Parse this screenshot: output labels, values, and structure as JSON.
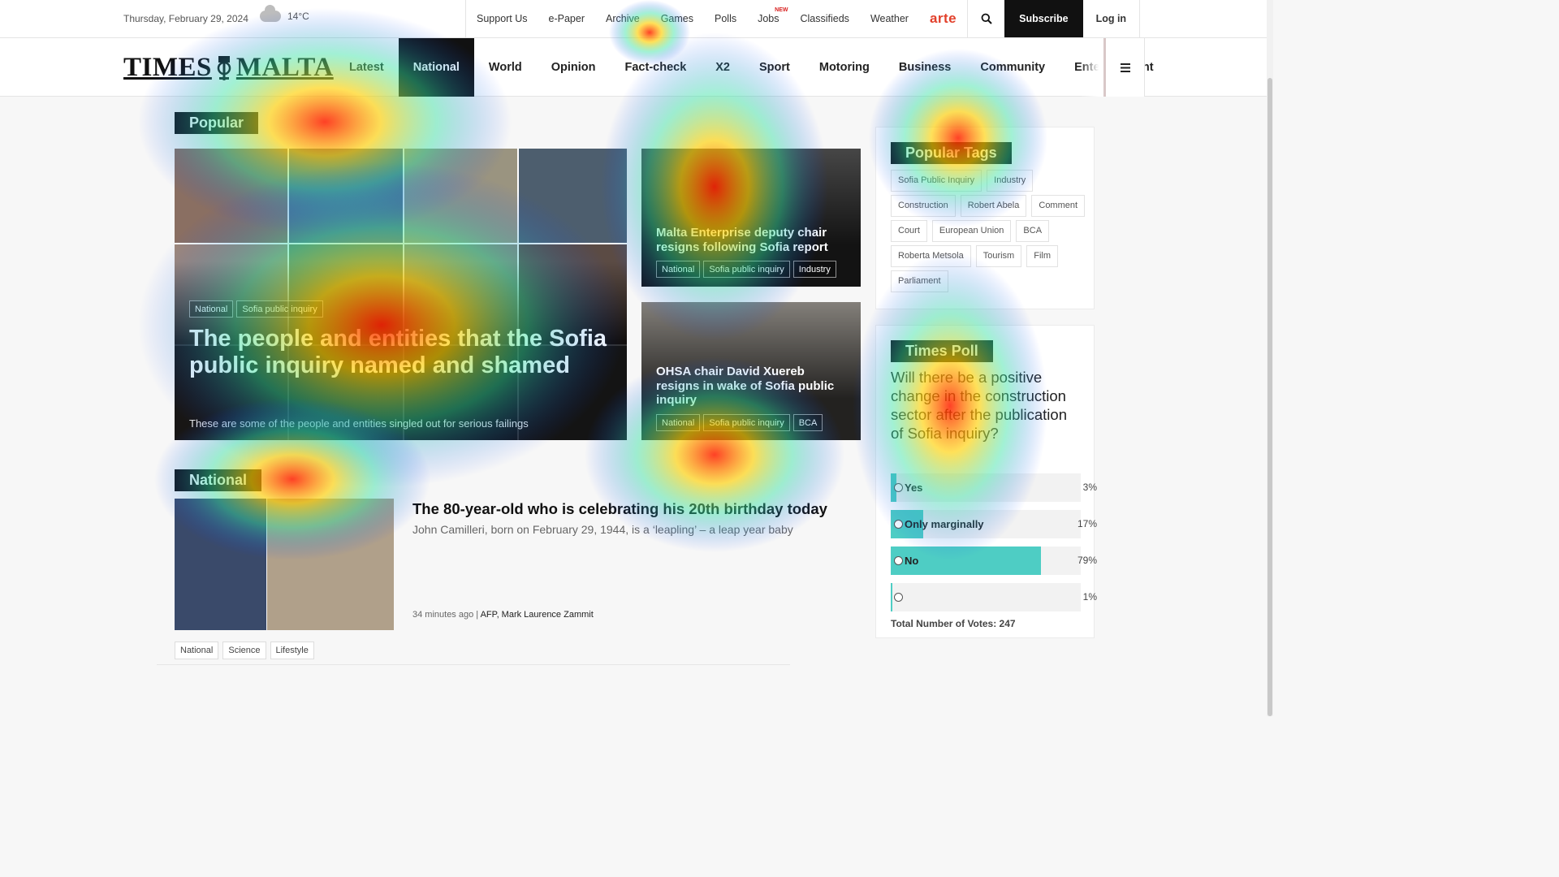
{
  "topbar": {
    "date": "Thursday, February 29, 2024",
    "temperature": "14°C",
    "links": [
      "Support Us",
      "e-Paper",
      "Archive",
      "Games",
      "Polls",
      "Jobs",
      "Classifieds",
      "Weather"
    ],
    "jobs_badge": "NEW",
    "arte": "arte",
    "subscribe": "Subscribe",
    "login": "Log in"
  },
  "nav": {
    "logo_left": "TIMES",
    "logo_right": "MALTA",
    "items": [
      "Latest",
      "National",
      "World",
      "Opinion",
      "Fact-check",
      "X2",
      "Sport",
      "Motoring",
      "Business",
      "Community",
      "Entertainment"
    ],
    "active": "National"
  },
  "popular": {
    "label": "Popular",
    "hero": {
      "tags": [
        "National",
        "Sofia public inquiry"
      ],
      "title": "The people and entities that the Sofia public inquiry named and shamed",
      "subtitle": "These are some of the people and entities singled out for serious failings"
    },
    "side": [
      {
        "title": "Malta Enterprise deputy chair resigns following Sofia report",
        "tags": [
          "National",
          "Sofia public inquiry",
          "Industry"
        ]
      },
      {
        "title": "OHSA chair David Xuereb resigns in wake of Sofia public inquiry",
        "tags": [
          "National",
          "Sofia public inquiry",
          "BCA"
        ]
      }
    ]
  },
  "national": {
    "label": "National",
    "article": {
      "title": "The 80-year-old who is celebrating his 20th birthday today",
      "subtitle": "John Camilleri, born on February 29, 1944, is a ‘leapling’ – a leap year baby",
      "time": "34 minutes ago",
      "separator": "|",
      "authors": "AFP, Mark Laurence Zammit",
      "tags": [
        "National",
        "Science",
        "Lifestyle"
      ]
    }
  },
  "popular_tags": {
    "label": "Popular Tags",
    "tags": [
      "Sofia Public Inquiry",
      "Industry",
      "Construction",
      "Robert Abela",
      "Comment",
      "Court",
      "European Union",
      "BCA",
      "Roberta Metsola",
      "Tourism",
      "Film",
      "Parliament"
    ]
  },
  "poll": {
    "label": "Times Poll",
    "question": "Will there be a positive change in the construction sector after the publication of Sofia inquiry?",
    "options": [
      {
        "label": "Yes",
        "percent": "3%",
        "value": 3
      },
      {
        "label": "Only marginally",
        "percent": "17%",
        "value": 17
      },
      {
        "label": "No",
        "percent": "79%",
        "value": 79
      },
      {
        "label": "",
        "percent": "1%",
        "value": 1
      }
    ],
    "total": "Total Number of Votes: 247"
  },
  "colors": {
    "accent_poll": "#4ecdc4",
    "brand_black": "#111111",
    "arte_red": "#e2402b"
  }
}
